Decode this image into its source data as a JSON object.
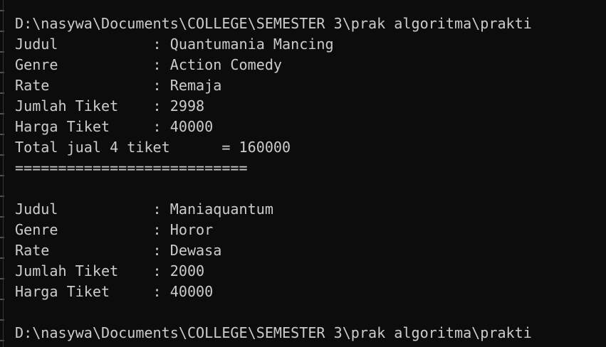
{
  "terminal": {
    "lines": [
      "D:\\nasywa\\Documents\\COLLEGE\\SEMESTER 3\\prak algoritma\\prakti",
      "Judul           : Quantumania Mancing",
      "Genre           : Action Comedy",
      "Rate            : Remaja",
      "Jumlah Tiket    : 2998",
      "Harga Tiket     : 40000",
      "Total jual 4 tiket      = 160000",
      "===========================",
      "",
      "Judul           : Maniaquantum",
      "Genre           : Horor",
      "Rate            : Dewasa",
      "Jumlah Tiket    : 2000",
      "Harga Tiket     : 40000",
      "",
      "D:\\nasywa\\Documents\\COLLEGE\\SEMESTER 3\\prak algoritma\\prakti"
    ]
  },
  "colors": {
    "background": "#0c0c0c",
    "foreground": "#cccccc"
  }
}
